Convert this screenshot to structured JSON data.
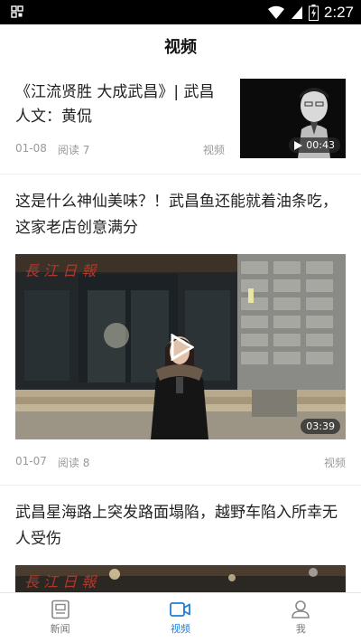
{
  "status_bar": {
    "time": "2:27"
  },
  "header": {
    "title": "视频"
  },
  "feed": [
    {
      "title": "《江流贤胜 大成武昌》| 武昌人文：黄侃",
      "date": "01-08",
      "reads": "阅读 7",
      "category": "视频",
      "duration": "00:43"
    },
    {
      "title": "这是什么神仙美味？！武昌鱼还能就着油条吃，这家老店创意满分",
      "date": "01-07",
      "reads": "阅读 8",
      "category": "视频",
      "duration": "03:39"
    },
    {
      "title": "武昌星海路上突发路面塌陷，越野车陷入所幸无人受伤"
    }
  ],
  "tabbar": [
    {
      "label": "新闻",
      "icon": "news-icon"
    },
    {
      "label": "视频",
      "icon": "video-icon",
      "active": true
    },
    {
      "label": "我",
      "icon": "profile-icon"
    }
  ],
  "colors": {
    "accent": "#1f7ed8",
    "meta": "#999999",
    "status_bar": "#000000"
  }
}
